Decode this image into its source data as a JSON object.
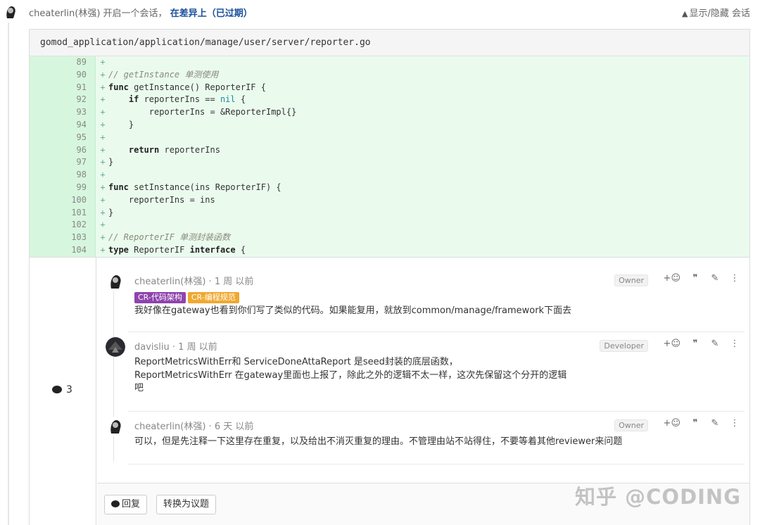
{
  "header": {
    "author": "cheaterlin(林强)",
    "action_text": "开启一个会话，",
    "status": "在差异上（已过期）",
    "toggle_label": "显示/隐藏 会话"
  },
  "file": {
    "path": "gomod_application/application/manage/user/server/reporter.go"
  },
  "code_lines": [
    {
      "num": "89",
      "text": ""
    },
    {
      "num": "90",
      "text": "// getInstance 单测使用"
    },
    {
      "num": "91",
      "text": "func getInstance() ReporterIF {"
    },
    {
      "num": "92",
      "text": "    if reporterIns == nil {"
    },
    {
      "num": "93",
      "text": "        reporterIns = &ReporterImpl{}"
    },
    {
      "num": "94",
      "text": "    }"
    },
    {
      "num": "95",
      "text": ""
    },
    {
      "num": "96",
      "text": "    return reporterIns"
    },
    {
      "num": "97",
      "text": "}"
    },
    {
      "num": "98",
      "text": ""
    },
    {
      "num": "99",
      "text": "func setInstance(ins ReporterIF) {"
    },
    {
      "num": "100",
      "text": "    reporterIns = ins"
    },
    {
      "num": "101",
      "text": "}"
    },
    {
      "num": "102",
      "text": ""
    },
    {
      "num": "103",
      "text": "// ReporterIF 单测封装函数"
    },
    {
      "num": "104",
      "text": "type ReporterIF interface {"
    }
  ],
  "discussion": {
    "count": "3",
    "notes": [
      {
        "author": "cheaterlin(林强)",
        "time": "1 周 以前",
        "role": "Owner",
        "labels": [
          {
            "text": "CR-代码架构",
            "color": "#8e44ad"
          },
          {
            "text": "CR-编程规范",
            "color": "#f0a830"
          }
        ],
        "body": [
          "我好像在gateway也看到你们写了类似的代码。如果能复用，就放到common/manage/framework下面去"
        ]
      },
      {
        "author": "davisliu",
        "time": "1 周 以前",
        "role": "Developer",
        "labels": [],
        "body": [
          "ReportMetricsWithErr和 ServiceDoneAttaReport 是seed封装的底层函数，",
          "ReportMetricsWithErr 在gateway里面也上报了，除此之外的逻辑不太一样，这次先保留这个分开的逻辑",
          "吧"
        ]
      },
      {
        "author": "cheaterlin(林强)",
        "time": "6 天 以前",
        "role": "Owner",
        "labels": [],
        "body": [
          "可以，但是先注释一下这里存在重复，以及给出不消灭重复的理由。不管理由站不站得住，不要等着其他reviewer来问题"
        ]
      }
    ],
    "actions": {
      "emoji": "+☺",
      "quote": "❞",
      "edit": "✎",
      "more": "⋮"
    },
    "reply_label": "回复",
    "convert_label": "转换为议题"
  },
  "watermark": "知乎 @CODING",
  "icons": [
    "avatar-icon",
    "chevron-up-icon",
    "comment-bubble-icon",
    "emoji-icon",
    "quote-icon",
    "edit-icon",
    "more-icon"
  ]
}
